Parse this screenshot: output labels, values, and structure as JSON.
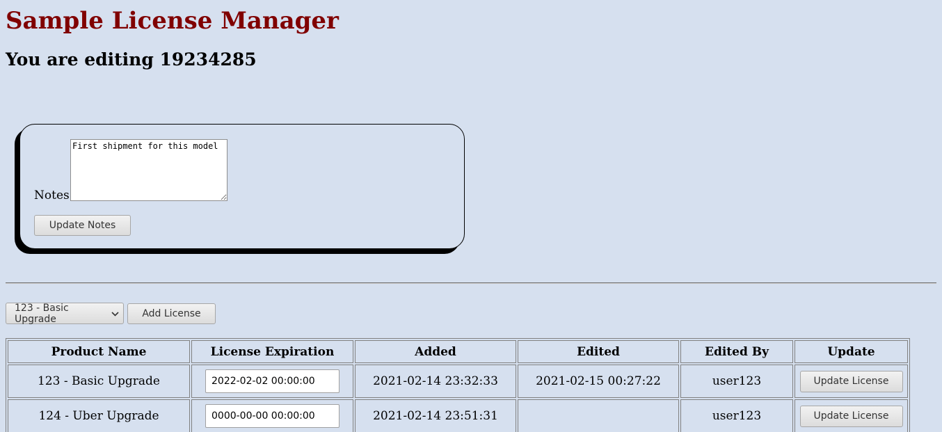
{
  "header": {
    "title": "Sample License Manager",
    "editing": "You are editing 19234285"
  },
  "notes": {
    "label": "Notes:",
    "value": "First shipment for this model",
    "update_button": "Update Notes"
  },
  "add_license": {
    "selected_product": "123 - Basic Upgrade",
    "button": "Add License"
  },
  "table": {
    "headers": [
      "Product Name",
      "License Expiration",
      "Added",
      "Edited",
      "Edited By",
      "Update"
    ],
    "rows": [
      {
        "product": "123 - Basic Upgrade",
        "expiration": "2022-02-02 00:00:00",
        "added": "2021-02-14 23:32:33",
        "edited": "2021-02-15 00:27:22",
        "edited_by": "user123",
        "button": "Update License"
      },
      {
        "product": "124 - Uber Upgrade",
        "expiration": "0000-00-00 00:00:00",
        "added": "2021-02-14 23:51:31",
        "edited": "",
        "edited_by": "user123",
        "button": "Update License"
      }
    ]
  },
  "colors": {
    "background": "#d6e0ef",
    "title": "#800000"
  }
}
